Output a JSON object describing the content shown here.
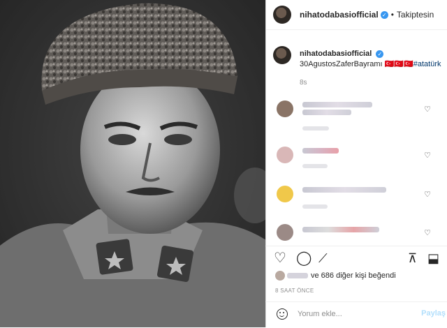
{
  "header": {
    "username": "nihatodabasiofficial",
    "separator": "•",
    "follow_label": "Takiptesin"
  },
  "caption": {
    "username": "nihatodabasiofficial",
    "text": "30AgustosZaferBayramı 🇹🇷🇹🇷🇹🇷",
    "hashtag": "#atatürk",
    "time": "8s"
  },
  "comments": [
    {
      "label": "blurred-comment-1"
    },
    {
      "label": "blurred-comment-2"
    },
    {
      "label": "blurred-comment-3"
    },
    {
      "label": "blurred-comment-4"
    }
  ],
  "likes": {
    "text": "ve 686 diğer kişi beğendi"
  },
  "posted_ago": "8 SAAT ÖNCE",
  "comment_box": {
    "placeholder": "Yorum ekle...",
    "share_label": "Paylaş"
  },
  "colors": {
    "verified": "#3897f0",
    "hashtag": "#00376b",
    "share_disabled": "#b2dffc"
  }
}
